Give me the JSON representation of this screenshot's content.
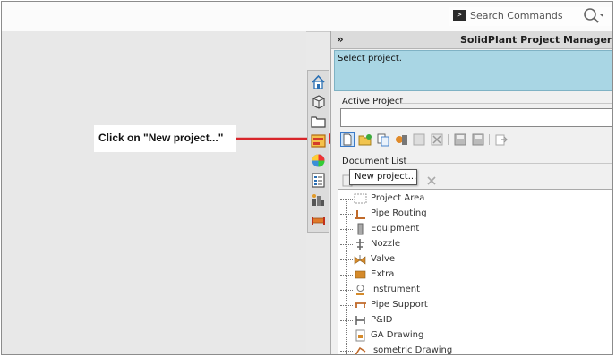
{
  "search": {
    "placeholder": "Search Commands"
  },
  "callout": {
    "text": "Click on \"New project...\""
  },
  "panel": {
    "collapse_glyph": "»",
    "title": "SolidPlant Project Manager",
    "status_text": "Select project.",
    "active_project_label": "Active Project",
    "active_project_value": "",
    "document_list_label": "Document List"
  },
  "tooltip": {
    "text": "New project..."
  },
  "vertical_tabs": [
    "home-icon",
    "parts-icon",
    "folder-icon",
    "project-manager-icon",
    "appearance-icon",
    "properties-icon",
    "plant-icon",
    "pipe-icon"
  ],
  "toolbar_buttons": [
    "new-project-icon",
    "open-project-icon",
    "copy-project-icon",
    "project-settings-icon",
    "edit-icon",
    "delete-icon",
    "save-icon",
    "save-as-icon",
    "export-icon"
  ],
  "tree": {
    "items": [
      {
        "label": "Project Area",
        "icon": "project-area-icon"
      },
      {
        "label": "Pipe Routing",
        "icon": "pipe-routing-icon"
      },
      {
        "label": "Equipment",
        "icon": "equipment-icon"
      },
      {
        "label": "Nozzle",
        "icon": "nozzle-icon"
      },
      {
        "label": "Valve",
        "icon": "valve-icon"
      },
      {
        "label": "Extra",
        "icon": "extra-icon"
      },
      {
        "label": "Instrument",
        "icon": "instrument-icon"
      },
      {
        "label": "Pipe Support",
        "icon": "pipe-support-icon"
      },
      {
        "label": "P&ID",
        "icon": "pid-icon"
      },
      {
        "label": "GA Drawing",
        "icon": "ga-drawing-icon"
      },
      {
        "label": "Isometric Drawing",
        "icon": "isometric-drawing-icon"
      }
    ]
  },
  "colors": {
    "status_bg": "#a9d6e4",
    "arrow": "#d8262b",
    "accent": "#2f6fb3"
  }
}
